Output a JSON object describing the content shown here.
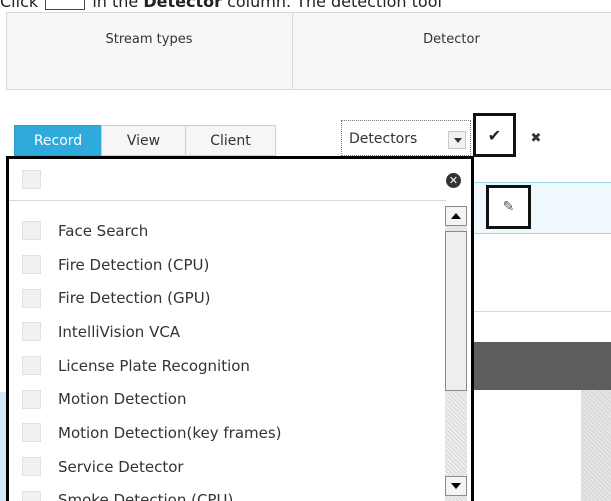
{
  "instruction": {
    "prefix": "Click",
    "middle": "in the",
    "bold": "Detector",
    "suffix": "column. The detection tool"
  },
  "table": {
    "col_stream_types": "Stream types",
    "col_detector": "Detector"
  },
  "stream_types": {
    "buttons": [
      {
        "label": "Record",
        "active": true
      },
      {
        "label": "View",
        "active": false
      },
      {
        "label": "Client",
        "active": false
      }
    ]
  },
  "detector_select": {
    "label": "Detectors"
  },
  "icons": {
    "confirm": "✔",
    "cancel": "✖",
    "edit": "✎",
    "close": "✕"
  },
  "dropdown": {
    "items": [
      "Face Search",
      "Fire Detection (CPU)",
      "Fire Detection (GPU)",
      "IntelliVision VCA",
      "License Plate Recognition",
      "Motion Detection",
      "Motion Detection(key frames)",
      "Service Detector",
      "Smoke Detection (CPU)"
    ]
  },
  "colors": {
    "active_button": "#2eaadc",
    "highlight_border": "#000000",
    "selected_row": "#f0f9fd"
  }
}
